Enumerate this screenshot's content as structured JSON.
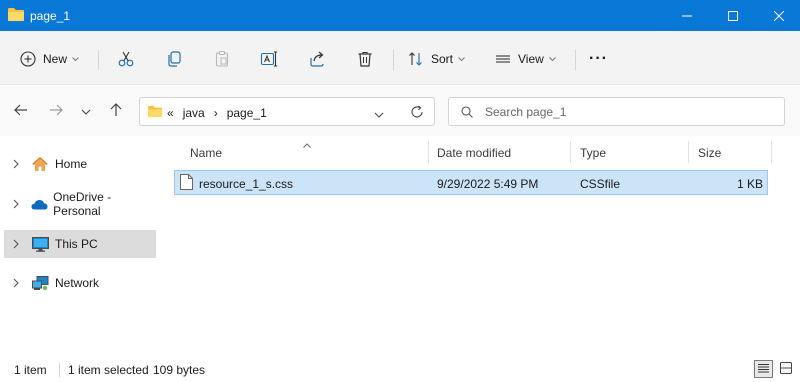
{
  "window": {
    "title": "page_1"
  },
  "commandbar": {
    "new_label": "New",
    "sort_label": "Sort",
    "view_label": "View",
    "more_label": "···"
  },
  "address": {
    "overflow": "«",
    "crumbs": [
      "java",
      "›",
      "page_1"
    ]
  },
  "search": {
    "placeholder": "Search page_1"
  },
  "sidebar": {
    "items": [
      {
        "label": "Home",
        "icon": "home-icon"
      },
      {
        "label": "OneDrive - Personal",
        "icon": "onedrive-cloud-icon"
      },
      {
        "label": "This PC",
        "icon": "pc-monitor-icon",
        "selected": true
      },
      {
        "label": "Network",
        "icon": "network-icon"
      }
    ]
  },
  "filelist": {
    "columns": [
      "Name",
      "Date modified",
      "Type",
      "Size"
    ],
    "rows": [
      {
        "name": "resource_1_s.css",
        "date": "9/29/2022 5:49 PM",
        "type": "CSSfile",
        "size": "1 KB",
        "selected": true
      }
    ]
  },
  "status": {
    "count": "1 item",
    "selection": "1 item selected",
    "bytes": "109 bytes"
  },
  "colors": {
    "titlebar": "#0a78d7",
    "selection": "#cce4f7",
    "folder": "#f5c242"
  }
}
